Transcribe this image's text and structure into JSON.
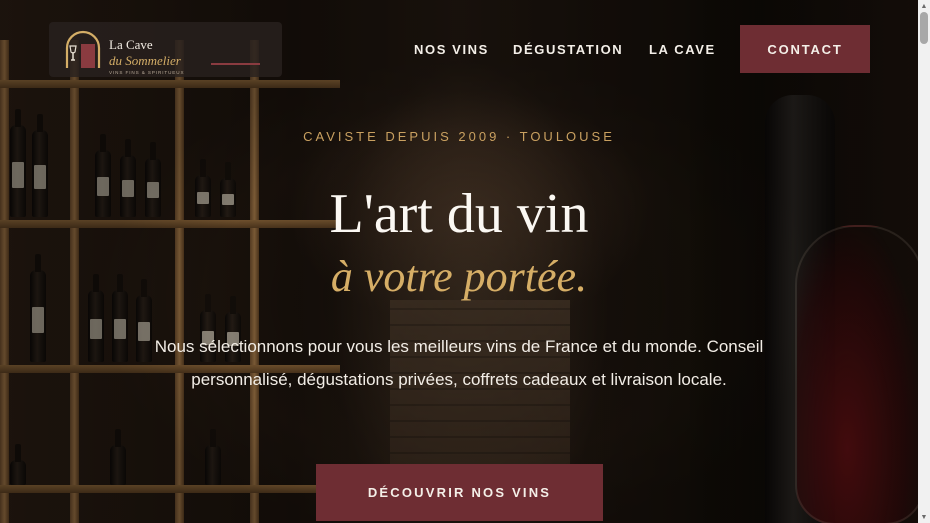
{
  "brand": {
    "name_line1": "La Cave",
    "name_line2": "du Sommelier",
    "tagline": "VINS FINS & SPIRITUEUX"
  },
  "nav": {
    "items": [
      {
        "label": "NOS VINS"
      },
      {
        "label": "DÉGUSTATION"
      },
      {
        "label": "LA CAVE"
      }
    ],
    "contact_label": "CONTACT"
  },
  "hero": {
    "eyebrow": "CAVISTE DEPUIS 2009 · TOULOUSE",
    "title_line1": "L'art du vin",
    "title_line2": "à votre portée.",
    "description": "Nous sélectionnons pour vous les meilleurs vins de France et du monde. Conseil personnalisé, dégustations privées, coffrets cadeaux et livraison locale.",
    "cta_label": "DÉCOUVRIR NOS VINS"
  },
  "colors": {
    "accent_burgundy": "#6e2d33",
    "accent_gold": "#d6ae66",
    "text_light": "#f4efe8"
  },
  "icons": {
    "logo": "wine-arch-logo-icon",
    "scroll_up": "triangle-up-icon",
    "scroll_down": "triangle-down-icon"
  }
}
